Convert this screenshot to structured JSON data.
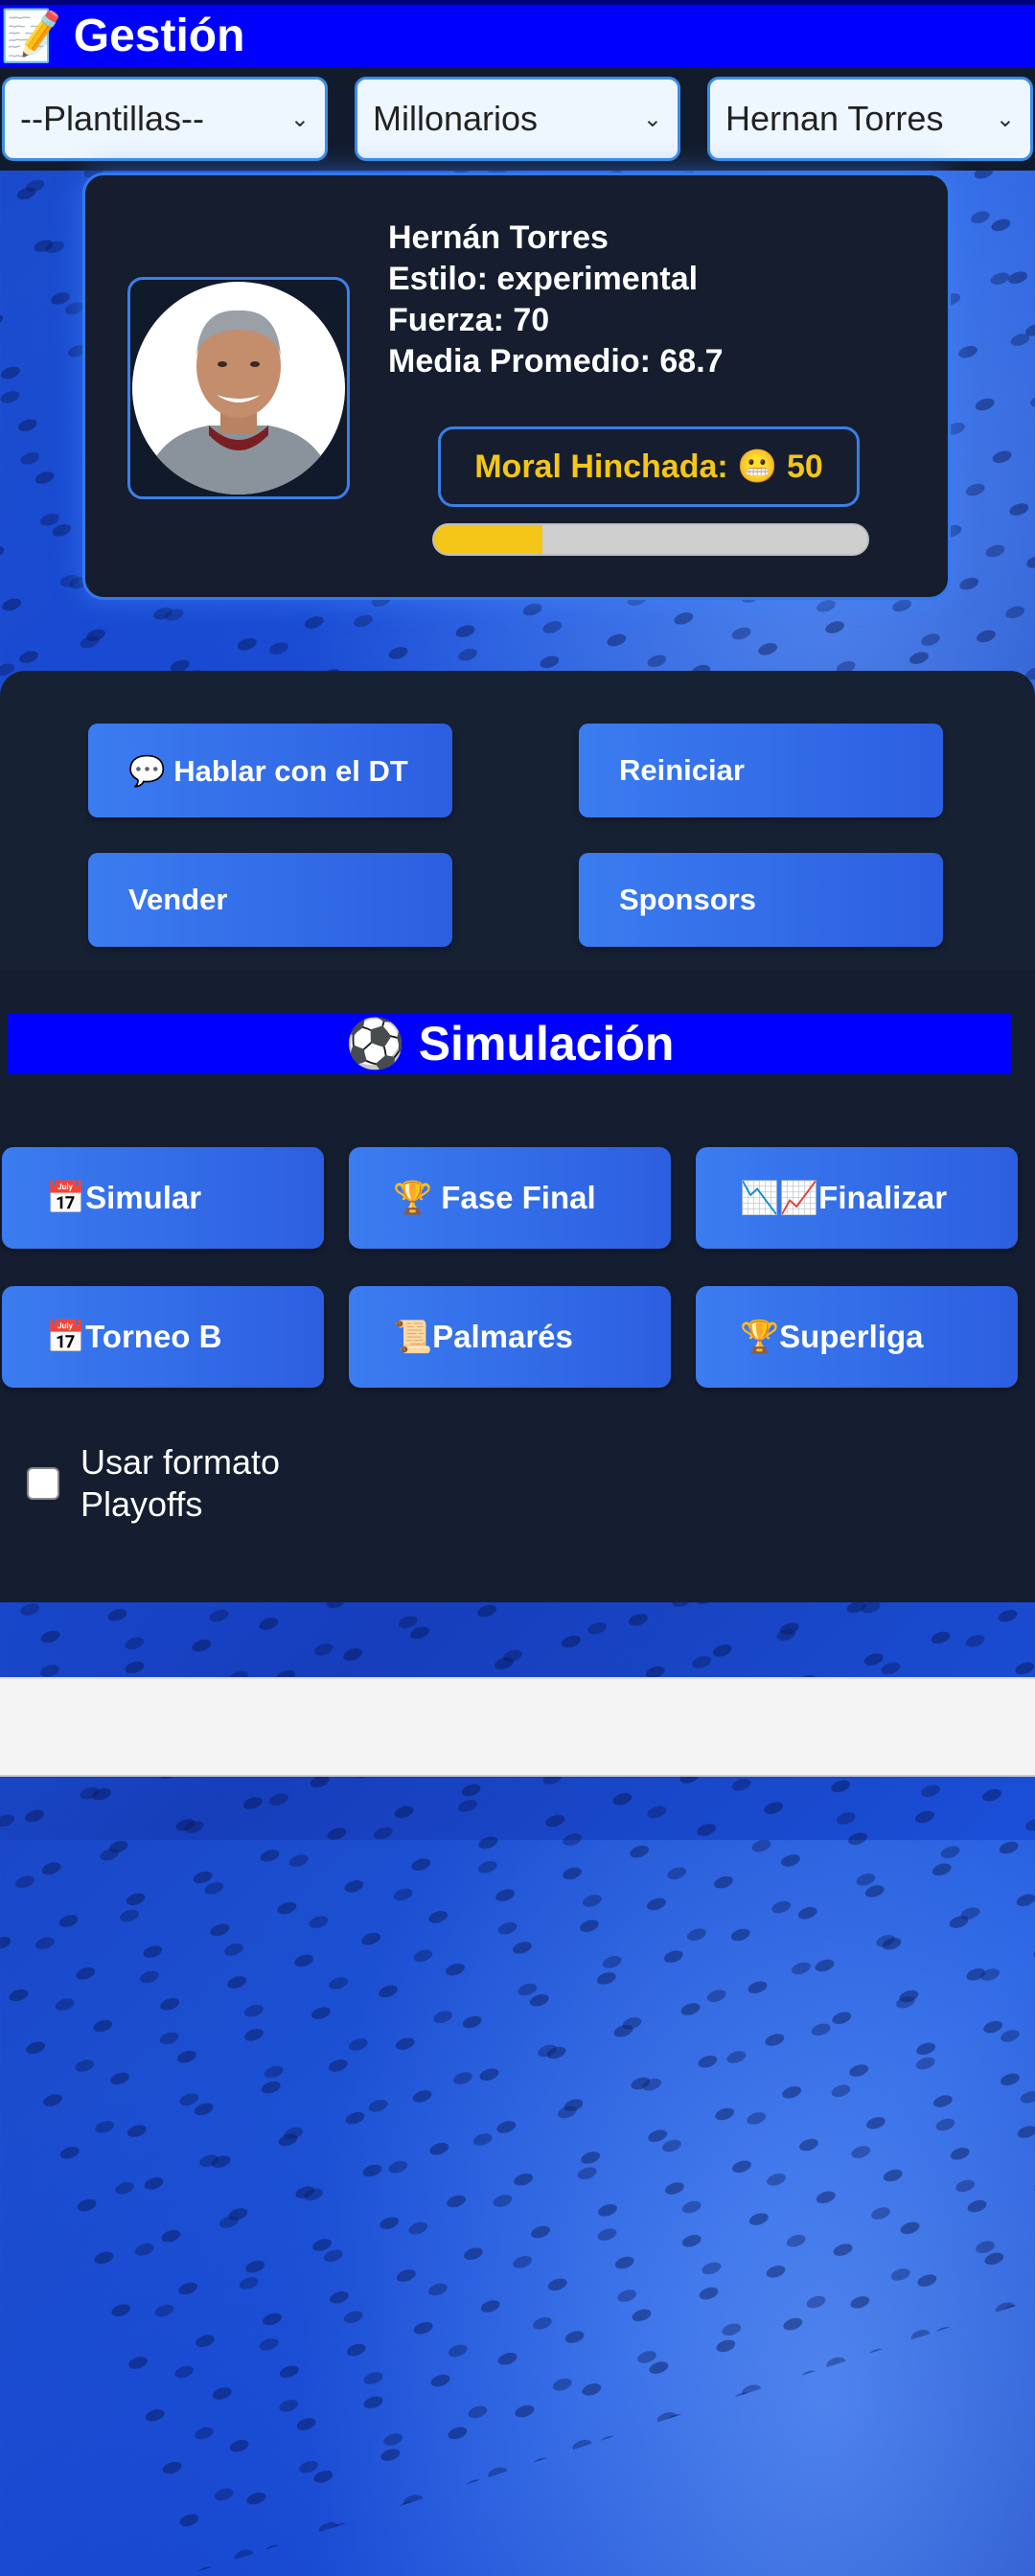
{
  "header": {
    "icon": "memo-icon",
    "emoji": "📝",
    "title": "Gestión"
  },
  "selects": {
    "plantillas": "--Plantillas--",
    "team": "Millonarios",
    "coach": "Hernan Torres"
  },
  "coach_card": {
    "name": "Hernán Torres",
    "style": "Estilo: experimental",
    "strength": "Fuerza: 70",
    "average": "Media Promedio: 68.7",
    "moral_label": "Moral Hinchada: 😬 50",
    "moral_value": 50,
    "moral_bar_fraction": 0.25
  },
  "actions": {
    "talk": "💬 Hablar con el DT",
    "reset": "Reiniciar",
    "sell": "Vender",
    "sponsors": "Sponsors"
  },
  "simulation": {
    "title": "⚽ Simulación",
    "buttons": {
      "simulate": "📅Simular",
      "final_phase": "🏆 Fase Final",
      "finish": "📉📈Finalizar",
      "tournament_b": "📅Torneo B",
      "palmares": "📜Palmarés",
      "superliga": "🏆Superliga"
    },
    "playoffs_label": "Usar formato Playoffs",
    "playoffs_checked": false
  },
  "colors": {
    "header_blue": "#0000ff",
    "button_blue": "#3b7cf0",
    "moral_yellow": "#f5c518",
    "panel_dark": "#151e30"
  }
}
